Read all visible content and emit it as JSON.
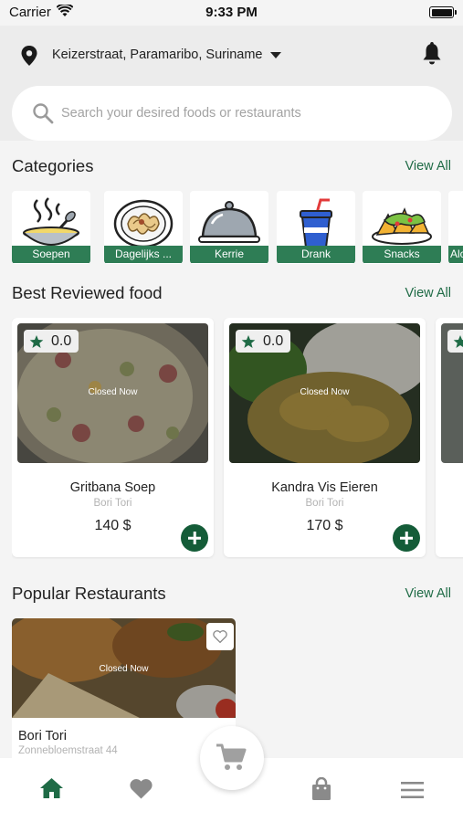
{
  "status_bar": {
    "carrier": "Carrier",
    "time": "9:33 PM"
  },
  "header": {
    "location": "Keizerstraat, Paramaribo, Suriname",
    "search_placeholder": "Search your desired foods or restaurants"
  },
  "categories": {
    "title": "Categories",
    "view_all": "View All",
    "items": [
      {
        "label": "Soepen",
        "icon": "soup-bowl-icon"
      },
      {
        "label": "Dagelijks ...",
        "icon": "noodle-plate-icon"
      },
      {
        "label": "Kerrie",
        "icon": "cloche-icon"
      },
      {
        "label": "Drank",
        "icon": "drink-cup-icon"
      },
      {
        "label": "Snacks",
        "icon": "nachos-icon"
      },
      {
        "label": "Alc",
        "icon": "alcohol-icon"
      }
    ]
  },
  "best_reviewed": {
    "title": "Best Reviewed food",
    "view_all": "View All",
    "items": [
      {
        "rating": "0.0",
        "status": "Closed Now",
        "name": "Gritbana Soep",
        "restaurant": "Bori Tori",
        "price": "140 $"
      },
      {
        "rating": "0.0",
        "status": "Closed Now",
        "name": "Kandra Vis Eieren",
        "restaurant": "Bori Tori",
        "price": "170 $"
      }
    ]
  },
  "popular_restaurants": {
    "title": "Popular Restaurants",
    "view_all": "View All",
    "items": [
      {
        "status": "Closed Now",
        "name": "Bori Tori",
        "address": "Zonnebloemstraat 44"
      }
    ]
  },
  "bottom_nav": {
    "items": [
      {
        "icon": "home-icon",
        "active": true
      },
      {
        "icon": "heart-icon",
        "active": false
      },
      {
        "icon": "cart-icon",
        "active": false
      },
      {
        "icon": "shopping-bag-icon",
        "active": false
      },
      {
        "icon": "menu-icon",
        "active": false
      }
    ]
  },
  "colors": {
    "accent": "#1f6b46",
    "label_bg": "#2e7d55",
    "add_button": "#145c38",
    "background": "#f4f4f4"
  }
}
